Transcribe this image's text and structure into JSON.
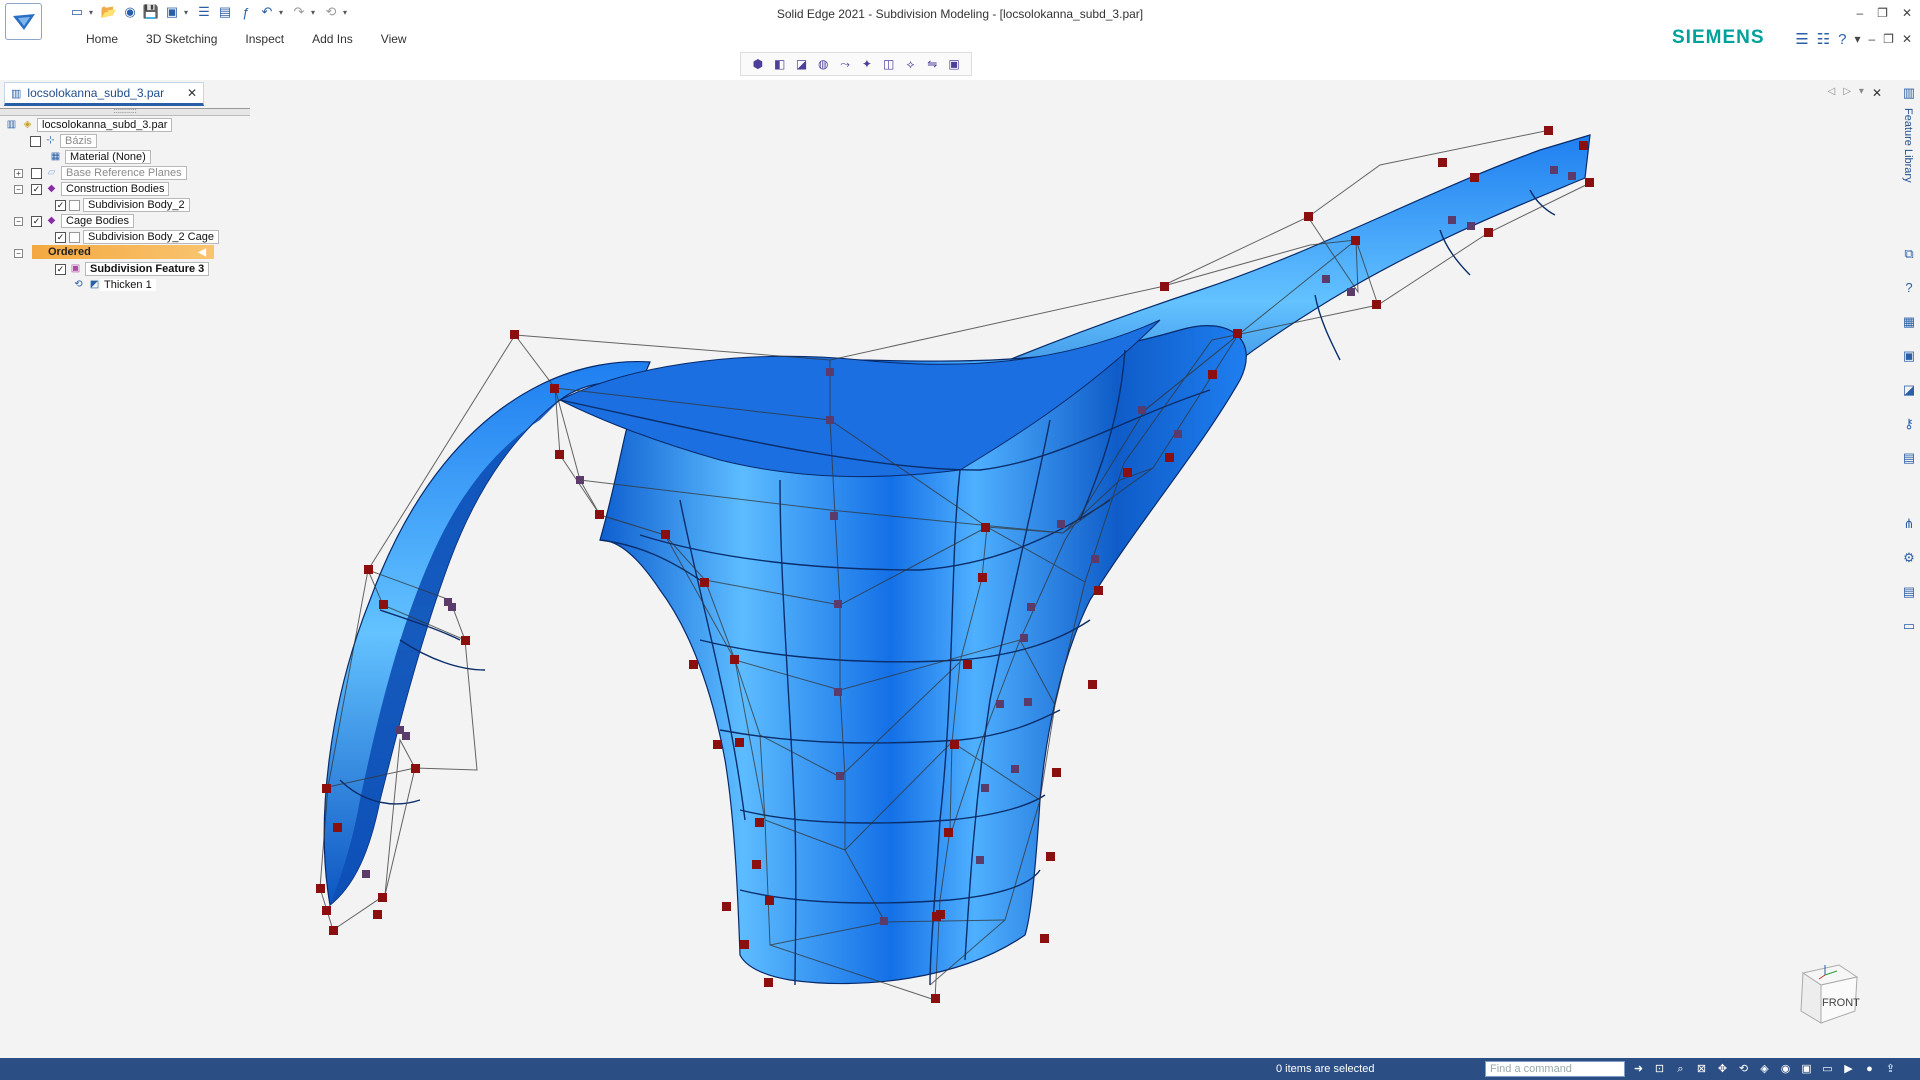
{
  "window": {
    "title": "Solid Edge 2021 - Subdivision Modeling - [locsolokanna_subd_3.par]",
    "brand": "SIEMENS",
    "brand_color": "#00a19b"
  },
  "ribbon": {
    "tabs": [
      "Home",
      "3D Sketching",
      "Inspect",
      "Add Ins",
      "View"
    ]
  },
  "quick_access": {
    "icons": [
      "new-icon",
      "open-icon",
      "save-icon",
      "save-as-icon",
      "properties-icon",
      "print-icon",
      "undo-icon",
      "redo-icon",
      "customize-icon"
    ]
  },
  "document_tab": {
    "name": "locsolokanna_subd_3.par",
    "close": "✕"
  },
  "pathfinder": {
    "header_grip": "::::::::::::",
    "root": "locsolokanna_subd_3.par",
    "items": [
      {
        "label": "Bázis",
        "dim": true
      },
      {
        "label": "Material (None)",
        "dim": false
      },
      {
        "label": "Base Reference Planes",
        "dim": true
      },
      {
        "label": "Construction Bodies",
        "dim": false
      },
      {
        "label": "Subdivision Body_2",
        "dim": false
      },
      {
        "label": "Cage Bodies",
        "dim": false
      },
      {
        "label": "Subdivision Body_2 Cage",
        "dim": false
      },
      {
        "label": "Ordered",
        "dim": false
      },
      {
        "label": "Subdivision Feature 3",
        "dim": false
      },
      {
        "label": "Thicken 1",
        "dim": false
      }
    ]
  },
  "sidebar_right": {
    "feature_library": "Feature Library"
  },
  "viewcube": {
    "face": "FRONT"
  },
  "status": {
    "selection": "0 items are selected",
    "find_placeholder": "Find a command"
  },
  "colors": {
    "model_blue": "#1f7ff0",
    "cage_points": "#8b0f0f",
    "statusbar": "#2b4f84",
    "ordered_highlight": "#f4a940"
  }
}
